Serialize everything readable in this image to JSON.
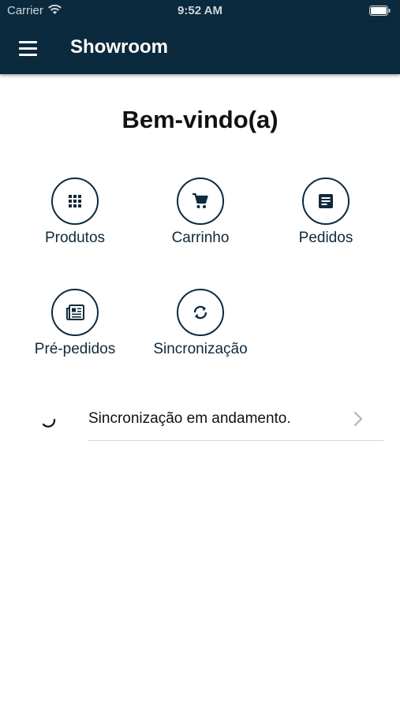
{
  "status_bar": {
    "carrier": "Carrier",
    "time": "9:52 AM"
  },
  "nav": {
    "title": "Showroom",
    "menu_icon": "hamburger-menu-icon"
  },
  "main": {
    "welcome": "Bem-vindo(a)",
    "tiles": [
      {
        "label": "Produtos",
        "icon": "grid-icon"
      },
      {
        "label": "Carrinho",
        "icon": "cart-icon"
      },
      {
        "label": "Pedidos",
        "icon": "document-icon"
      },
      {
        "label": "Pré-pedidos",
        "icon": "newspaper-icon"
      },
      {
        "label": "Sincronização",
        "icon": "sync-icon"
      }
    ],
    "sync_status": "Sincronização em andamento."
  },
  "colors": {
    "navbar": "#0b2a3d",
    "primary": "#0f2a3c",
    "background": "#ffffff",
    "divider": "#d9d9d9"
  }
}
